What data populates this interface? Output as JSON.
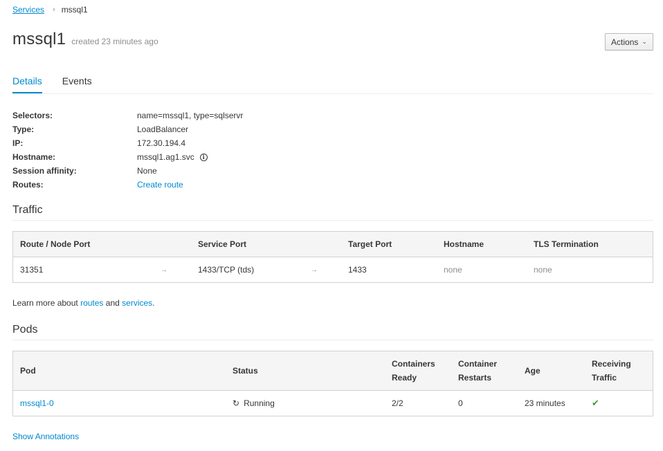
{
  "breadcrumb": {
    "parent": "Services",
    "separator": "›",
    "current": "mssql1"
  },
  "header": {
    "title": "mssql1",
    "created": "created 23 minutes ago",
    "actions_label": "Actions"
  },
  "tabs": [
    {
      "label": "Details",
      "active": true
    },
    {
      "label": "Events",
      "active": false
    }
  ],
  "details": {
    "selectors": {
      "key": "Selectors:",
      "value": "name=mssql1, type=sqlservr"
    },
    "type": {
      "key": "Type:",
      "value": "LoadBalancer"
    },
    "ip": {
      "key": "IP:",
      "value": "172.30.194.4"
    },
    "hostname": {
      "key": "Hostname:",
      "value": "mssql1.ag1.svc"
    },
    "session_affinity": {
      "key": "Session affinity:",
      "value": "None"
    },
    "routes": {
      "key": "Routes:",
      "value": "Create route"
    }
  },
  "traffic": {
    "title": "Traffic",
    "headers": {
      "route_node_port": "Route / Node Port",
      "service_port": "Service Port",
      "target_port": "Target Port",
      "hostname": "Hostname",
      "tls": "TLS Termination"
    },
    "row": {
      "route_node_port": "31351",
      "service_port": "1433/TCP (tds)",
      "target_port": "1433",
      "hostname": "none",
      "tls": "none",
      "arrow": "→"
    }
  },
  "learn_more": {
    "prefix": "Learn more about",
    "routes": "routes",
    "and": "and",
    "services": "services",
    "suffix": "."
  },
  "pods": {
    "title": "Pods",
    "headers": {
      "pod": "Pod",
      "status": "Status",
      "containers_ready_1": "Containers",
      "containers_ready_2": "Ready",
      "container_restarts_1": "Container",
      "container_restarts_2": "Restarts",
      "age": "Age",
      "receiving_1": "Receiving",
      "receiving_2": "Traffic"
    },
    "row": {
      "pod": "mssql1-0",
      "status": "Running",
      "containers_ready": "2/2",
      "container_restarts": "0",
      "age": "23 minutes",
      "receiving": true
    }
  },
  "show_annotations": "Show Annotations",
  "colors": {
    "link": "#0088ce",
    "text": "#363636",
    "muted": "#8b8d8f",
    "success": "#3f9c35"
  }
}
